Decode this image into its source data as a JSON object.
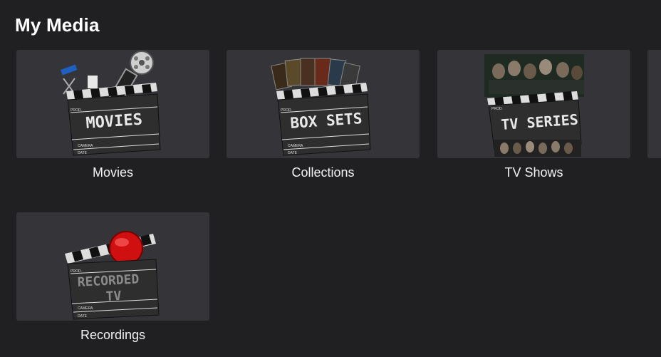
{
  "header": {
    "title": "My Media"
  },
  "libraries": [
    {
      "label": "Movies",
      "art_title": "MOVIES",
      "icon": "movies-clapperboard"
    },
    {
      "label": "Collections",
      "art_title": "BOX SETS",
      "icon": "boxsets-clapperboard"
    },
    {
      "label": "TV Shows",
      "art_title": "TV SERIES",
      "icon": "tvseries-clapperboard"
    },
    {
      "label": "Recordings",
      "art_title_line1": "RECORDED",
      "art_title_line2": "TV",
      "icon": "recorded-tv-clapperboard"
    }
  ],
  "clapper_fields": {
    "prod": "PROD.",
    "camera": "CAMERA",
    "date": "DATE"
  },
  "colors": {
    "background": "#201f22",
    "card": "#353438",
    "text": "#ffffff",
    "record_red": "#d01010"
  }
}
